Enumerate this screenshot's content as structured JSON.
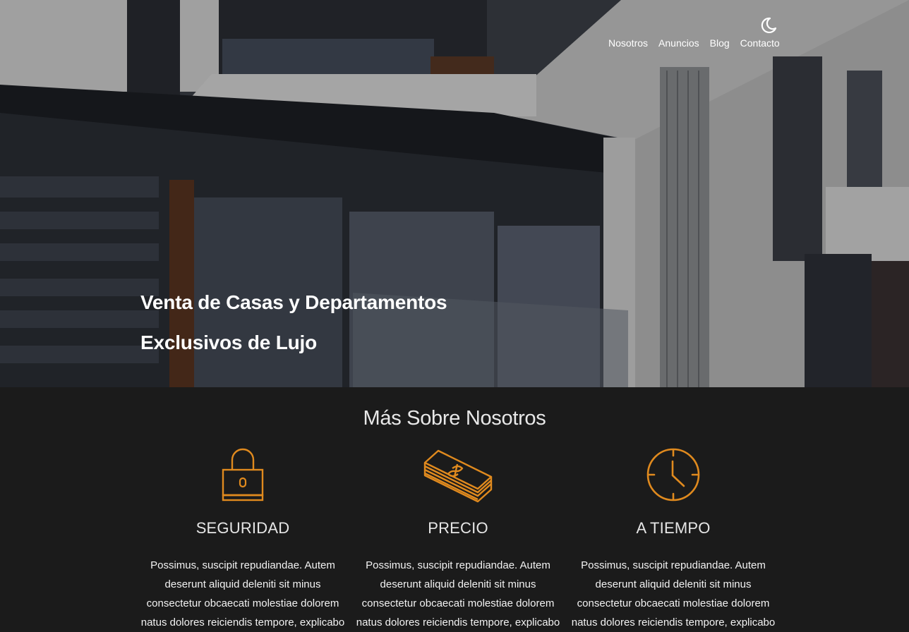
{
  "header": {
    "nav": [
      "Nosotros",
      "Anuncios",
      "Blog",
      "Contacto"
    ],
    "theme_toggle_icon": "moon-icon"
  },
  "hero": {
    "title_line1": "Venta de Casas y Departamentos",
    "title_line2": "Exclusivos de Lujo"
  },
  "about": {
    "title": "Más Sobre Nosotros",
    "accent_color": "#e08a1e",
    "features": [
      {
        "icon": "padlock-icon",
        "title": "SEGURIDAD",
        "text": "Possimus, suscipit repudiandae. Autem deserunt aliquid deleniti sit minus consectetur obcaecati molestiae dolorem natus dolores reiciendis tempore, explicabo"
      },
      {
        "icon": "money-stack-icon",
        "title": "PRECIO",
        "text": "Possimus, suscipit repudiandae. Autem deserunt aliquid deleniti sit minus consectetur obcaecati molestiae dolorem natus dolores reiciendis tempore, explicabo"
      },
      {
        "icon": "clock-icon",
        "title": "A TIEMPO",
        "text": "Possimus, suscipit repudiandae. Autem deserunt aliquid deleniti sit minus consectetur obcaecati molestiae dolorem natus dolores reiciendis tempore, explicabo"
      }
    ]
  }
}
